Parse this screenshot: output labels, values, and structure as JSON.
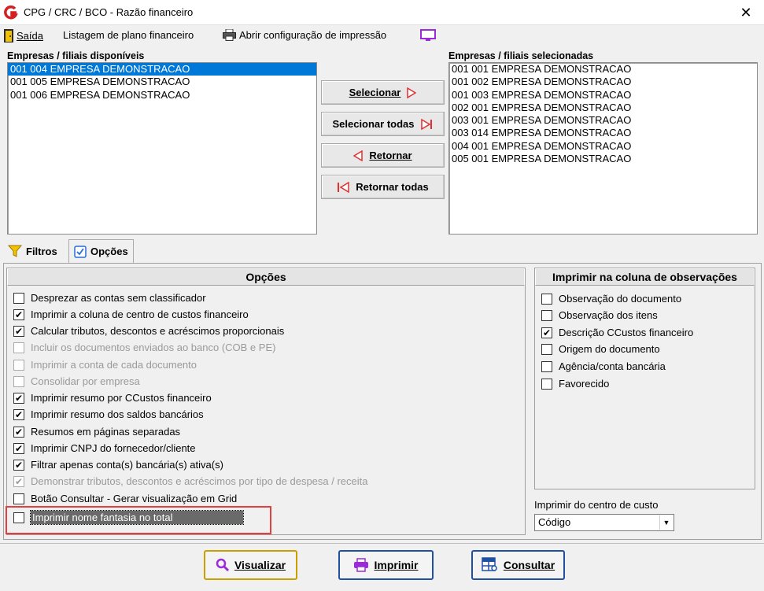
{
  "window": {
    "title": "CPG / CRC / BCO - Razão financeiro"
  },
  "menu": {
    "exit": "Saída",
    "listing": "Listagem de plano financeiro",
    "print_config": "Abrir configuração de impressão"
  },
  "available": {
    "label": "Empresas / filiais disponíveis",
    "items": [
      "001 004 EMPRESA DEMONSTRACAO",
      "001 005 EMPRESA DEMONSTRACAO",
      "001 006 EMPRESA DEMONSTRACAO"
    ]
  },
  "selected": {
    "label": "Empresas / filiais selecionadas",
    "items": [
      "001 001 EMPRESA DEMONSTRACAO",
      "001 002 EMPRESA DEMONSTRACAO",
      "001 003 EMPRESA DEMONSTRACAO",
      "002 001 EMPRESA DEMONSTRACAO",
      "003 001 EMPRESA DEMONSTRACAO",
      "003 014 EMPRESA DEMONSTRACAO",
      "004 001 EMPRESA DEMONSTRACAO",
      "005 001 EMPRESA DEMONSTRACAO"
    ]
  },
  "transfer": {
    "select": "Selecionar",
    "select_all": "Selecionar todas",
    "return": "Retornar",
    "return_all": "Retornar todas"
  },
  "tabs": {
    "filters": "Filtros",
    "options": "Opções"
  },
  "options": {
    "title": "Opções",
    "items": [
      {
        "label": "Desprezar as contas sem classificador",
        "checked": false,
        "enabled": true
      },
      {
        "label": "Imprimir a coluna de centro de custos financeiro",
        "checked": true,
        "enabled": true
      },
      {
        "label": "Calcular tributos, descontos e acréscimos proporcionais",
        "checked": true,
        "enabled": true
      },
      {
        "label": "Incluir os documentos enviados ao banco (COB e PE)",
        "checked": false,
        "enabled": false
      },
      {
        "label": "Imprimir a conta de cada documento",
        "checked": false,
        "enabled": false
      },
      {
        "label": "Consolidar por empresa",
        "checked": false,
        "enabled": false
      },
      {
        "label": "Imprimir resumo por CCustos financeiro",
        "checked": true,
        "enabled": true
      },
      {
        "label": "Imprimir resumo dos saldos bancários",
        "checked": true,
        "enabled": true
      },
      {
        "label": "Resumos em páginas separadas",
        "checked": true,
        "enabled": true
      },
      {
        "label": "Imprimir CNPJ do fornecedor/cliente",
        "checked": true,
        "enabled": true
      },
      {
        "label": "Filtrar apenas conta(s) bancária(s) ativa(s)",
        "checked": true,
        "enabled": true
      },
      {
        "label": "Demonstrar tributos, descontos e acréscimos por tipo de despesa / receita",
        "checked": true,
        "enabled": false
      },
      {
        "label": "Botão Consultar - Gerar visualização em Grid",
        "checked": false,
        "enabled": true
      },
      {
        "label": "Imprimir nome fantasia no total",
        "checked": false,
        "enabled": true
      }
    ]
  },
  "observations": {
    "title": "Imprimir na coluna de observações",
    "items": [
      {
        "label": "Observação do documento",
        "checked": false
      },
      {
        "label": "Observação dos itens",
        "checked": false
      },
      {
        "label": "Descrição CCustos financeiro",
        "checked": true
      },
      {
        "label": "Origem do documento",
        "checked": false
      },
      {
        "label": "Agência/conta bancária",
        "checked": false
      },
      {
        "label": "Favorecido",
        "checked": false
      }
    ]
  },
  "cost_center": {
    "label": "Imprimir do centro de custo",
    "value": "Código"
  },
  "actions": {
    "view": "Visualizar",
    "print": "Imprimir",
    "query": "Consultar"
  }
}
